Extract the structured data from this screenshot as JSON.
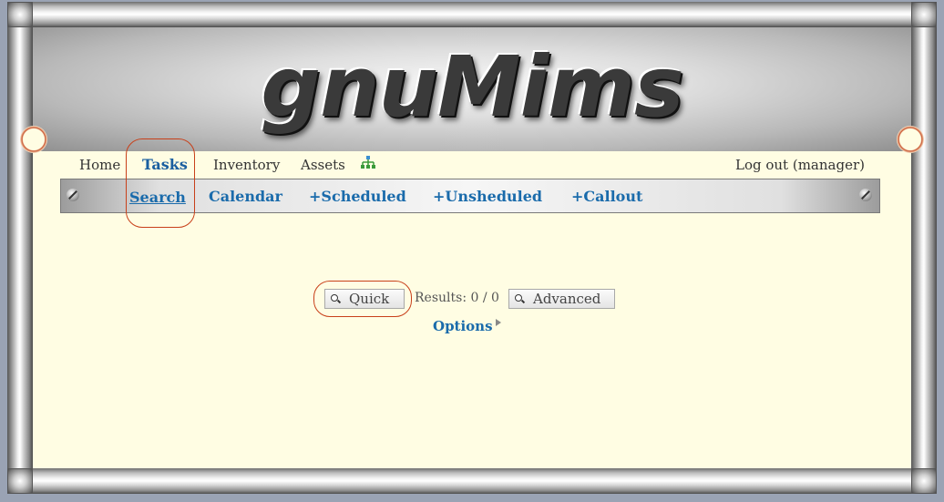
{
  "app": {
    "logo_text": "gnuMims"
  },
  "topnav": {
    "home": "Home",
    "tasks": "Tasks",
    "inventory": "Inventory",
    "assets": "Assets",
    "logout": "Log out (manager)"
  },
  "subnav": {
    "search": "Search",
    "calendar": "Calendar",
    "scheduled": "+Scheduled",
    "unscheduled": "+Unsheduled",
    "callout": "+Callout"
  },
  "search": {
    "quick_label": "Quick",
    "results_text": "Results: 0 / 0",
    "advanced_label": "Advanced",
    "options_label": "Options"
  },
  "colors": {
    "page_bg": "#fffde3",
    "link_blue": "#1a6bab",
    "highlight_ring": "#c8401a"
  },
  "icons": [
    "site-tree-icon",
    "magnifier-icon",
    "triangle-right-icon",
    "screw-icon"
  ]
}
